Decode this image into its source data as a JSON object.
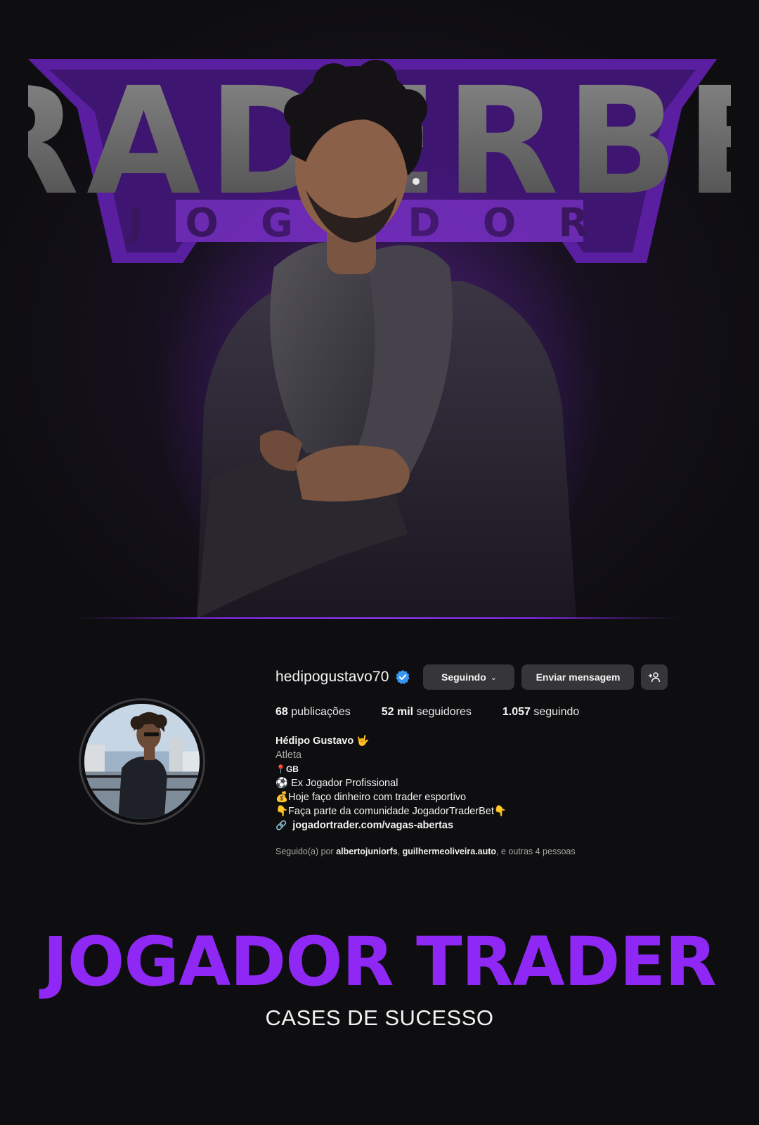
{
  "hero": {
    "banner_text": "TRADERBET",
    "banner_subtext": "JOGADOR",
    "accent_color": "#8b2cf5"
  },
  "profile": {
    "username": "hedipogustavo70",
    "verified_icon": "verified-badge-icon",
    "follow_button": "Seguindo",
    "message_button": "Enviar mensagem",
    "add_person_icon": "+ꝏ",
    "stats": {
      "posts_count": "68",
      "posts_label": "publicações",
      "followers_count": "52 mil",
      "followers_label": "seguidores",
      "following_count": "1.057",
      "following_label": "seguindo"
    },
    "bio": {
      "name": "Hédipo Gustavo 🤟",
      "category": "Atleta",
      "line_location": "📍GB",
      "line_1": "⚽ Ex Jogador Profissional",
      "line_2": "💰Hoje faço dinheiro com trader esportivo",
      "line_3": "👇Faça parte da comunidade JogadorTraderBet👇",
      "link": "jogadortrader.com/vagas-abertas"
    },
    "followed_by": {
      "prefix": "Seguido(a) por",
      "user_1": "albertojuniorfs",
      "user_2": "guilhermeoliveira.auto",
      "suffix": ", e outras 4 pessoas"
    }
  },
  "footer": {
    "title": "JOGADOR TRADER",
    "subtitle": "CASES DE SUCESSO"
  }
}
